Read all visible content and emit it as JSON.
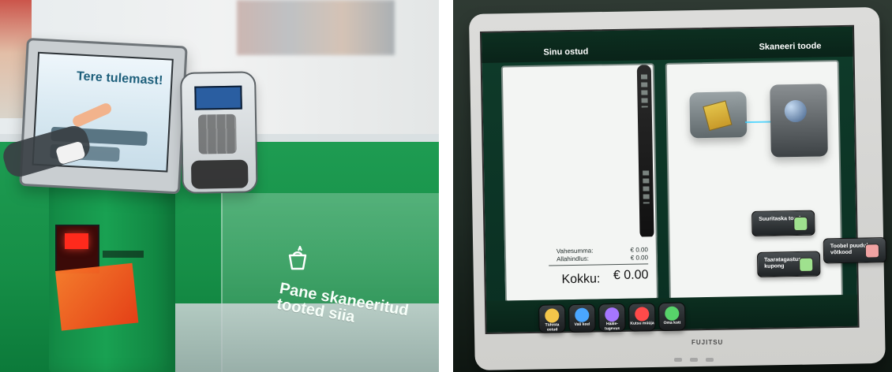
{
  "left_kiosk": {
    "screen_heading": "Tere tulemast!",
    "bagging_area_text": "Pane skaneeritud tooted siia"
  },
  "right_kiosk": {
    "top_left_label": "Sinu ostud",
    "top_right_label": "Skaneeri toode",
    "totals": {
      "subtotal_label": "Vahesumma:",
      "subtotal_value": "€ 0.00",
      "discount_label": "Allahindlus:",
      "discount_value": "€ 0.00",
      "total_label": "Kokku:",
      "total_value": "€ 0.00"
    },
    "action_buttons": {
      "large_item": "Suuritaska toode",
      "deposit_coupon": "Taaratagastus-kupong",
      "unrecognized_item": "Toobel puudub võtkood"
    },
    "bottom_buttons": [
      {
        "label": "Tühista ostud",
        "icon": "x-icon",
        "color": "#f3c64a"
      },
      {
        "label": "Vali keel",
        "icon": "speech-bubble-icon",
        "color": "#4aa6ff"
      },
      {
        "label": "Hääle-tugevus",
        "icon": "speaker-icon",
        "color": "#a676ff"
      },
      {
        "label": "Kutsu müüja",
        "icon": "help-icon",
        "color": "#ff4a4a"
      },
      {
        "label": "Oma kott",
        "icon": "minus-icon",
        "color": "#57d36a"
      }
    ],
    "brand": "FUJITSU"
  }
}
